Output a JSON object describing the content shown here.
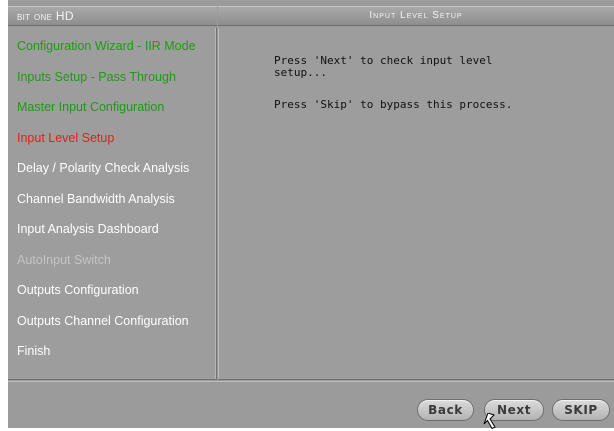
{
  "app": {
    "title": "bit one HD",
    "page_title": "Input Level Setup"
  },
  "sidebar": {
    "items": [
      {
        "label": "Configuration Wizard - IIR Mode",
        "state": "done"
      },
      {
        "label": "Inputs Setup - Pass Through",
        "state": "done"
      },
      {
        "label": "Master Input Configuration",
        "state": "done"
      },
      {
        "label": "Input Level Setup",
        "state": "active"
      },
      {
        "label": "Delay / Polarity Check Analysis",
        "state": "pending"
      },
      {
        "label": "Channel Bandwidth Analysis",
        "state": "pending"
      },
      {
        "label": "Input Analysis Dashboard",
        "state": "pending"
      },
      {
        "label": "AutoInput Switch",
        "state": "disabled"
      },
      {
        "label": "Outputs Configuration",
        "state": "pending"
      },
      {
        "label": "Outputs Channel Configuration",
        "state": "pending"
      },
      {
        "label": "Finish",
        "state": "pending"
      }
    ]
  },
  "content": {
    "line1": "Press 'Next' to check input level\nsetup...",
    "line2": "Press 'Skip' to bypass this process."
  },
  "footer": {
    "back_label": "Back",
    "next_label": "Next",
    "skip_label": "SKIP"
  },
  "colors": {
    "done": "#1f9a16",
    "active": "#e01f1f",
    "pending": "#ffffff",
    "disabled": "#c4c4c4"
  }
}
